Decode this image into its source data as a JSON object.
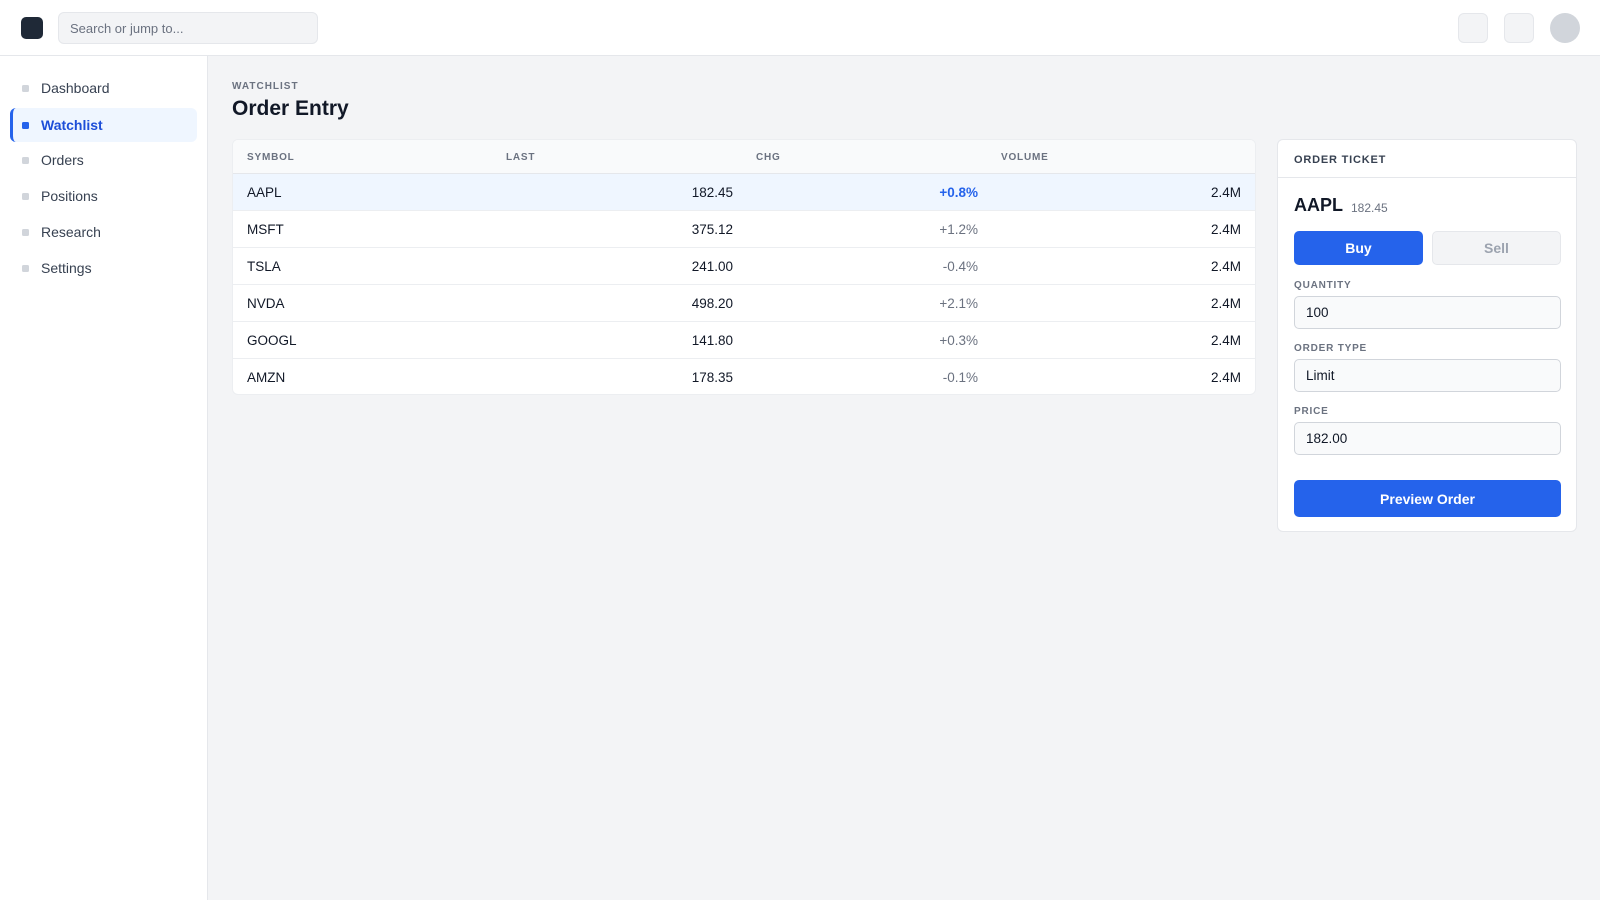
{
  "topbar": {
    "search_placeholder": "Search or jump to..."
  },
  "sidebar": {
    "items": [
      {
        "label": "Dashboard",
        "active": false
      },
      {
        "label": "Watchlist",
        "active": true
      },
      {
        "label": "Orders",
        "active": false
      },
      {
        "label": "Positions",
        "active": false
      },
      {
        "label": "Research",
        "active": false
      },
      {
        "label": "Settings",
        "active": false
      }
    ]
  },
  "main": {
    "eyebrow": "WATCHLIST",
    "title": "Order Entry"
  },
  "table": {
    "headers": {
      "symbol": "SYMBOL",
      "last": "LAST",
      "chg": "CHG",
      "volume": "VOLUME"
    },
    "rows": [
      {
        "symbol": "AAPL",
        "last": "182.45",
        "chg": "+0.8%",
        "volume": "2.4M",
        "selected": true
      },
      {
        "symbol": "MSFT",
        "last": "375.12",
        "chg": "+1.2%",
        "volume": "2.4M",
        "selected": false
      },
      {
        "symbol": "TSLA",
        "last": "241.00",
        "chg": "-0.4%",
        "volume": "2.4M",
        "selected": false
      },
      {
        "symbol": "NVDA",
        "last": "498.20",
        "chg": "+2.1%",
        "volume": "2.4M",
        "selected": false
      },
      {
        "symbol": "GOOGL",
        "last": "141.80",
        "chg": "+0.3%",
        "volume": "2.4M",
        "selected": false
      },
      {
        "symbol": "AMZN",
        "last": "178.35",
        "chg": "-0.1%",
        "volume": "2.4M",
        "selected": false
      }
    ]
  },
  "ticket": {
    "title": "ORDER TICKET",
    "symbol": "AAPL",
    "price": "182.45",
    "buy_label": "Buy",
    "sell_label": "Sell",
    "quantity_label": "QUANTITY",
    "quantity_value": "100",
    "order_type_label": "ORDER TYPE",
    "order_type_value": "Limit",
    "price_label": "PRICE",
    "price_value": "182.00",
    "preview_label": "Preview Order"
  },
  "colors": {
    "accent": "#2563eb",
    "accent_light": "#eff6ff",
    "sidebar_active_text": "#1d4ed8",
    "muted_text": "#6b7280",
    "page_bg": "#f3f4f6"
  },
  "icons": {
    "logo": "app-logo-icon",
    "toolbar_1": "notifications-icon",
    "toolbar_2": "help-icon",
    "nav_bullet": "square-bullet-icon"
  }
}
